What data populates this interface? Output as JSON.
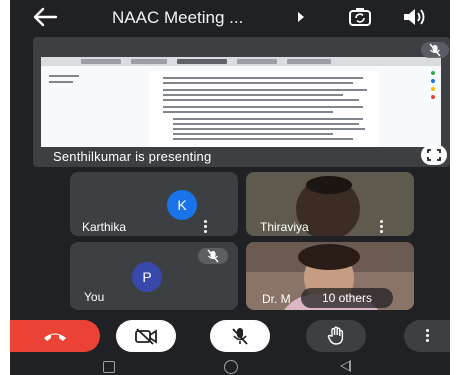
{
  "header": {
    "title": "NAAC Meeting ...",
    "back_icon": "arrow-back-icon",
    "camera_switch_icon": "camera-switch-icon",
    "speaker_icon": "speaker-icon"
  },
  "presentation": {
    "presenter_label": "Senthilkumar is presenting",
    "mic_status_icon": "mic-off-icon",
    "fullscreen_icon": "fullscreen-icon"
  },
  "participants": [
    {
      "name": "Karthika",
      "initial": "K",
      "avatar_color": "#1a73e8"
    },
    {
      "name": "Thiraviya"
    },
    {
      "name": "You",
      "initial": "P",
      "avatar_color": "#3949ab",
      "muted": true
    },
    {
      "name": "Dr. M"
    }
  ],
  "others_chip": "10 others",
  "controls": {
    "end_call_icon": "call-end-icon",
    "camera_icon": "camera-off-icon",
    "mic_icon": "mic-off-icon",
    "hand_icon": "raise-hand-icon",
    "more_icon": "more-vert-icon"
  },
  "colors": {
    "background": "#202124",
    "tile": "#3c4043",
    "end_call": "#ea4335",
    "accent": "#1a73e8"
  }
}
